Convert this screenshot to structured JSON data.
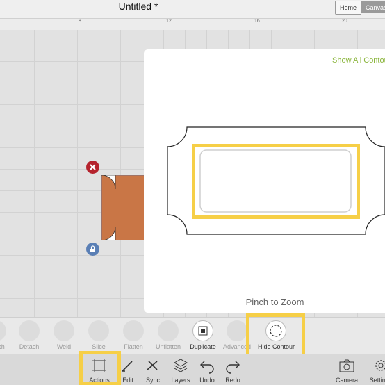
{
  "header": {
    "title": "Untitled *",
    "tabs": [
      "Home",
      "Canvas"
    ]
  },
  "ruler": {
    "ticks": [
      "8",
      "12",
      "16",
      "20"
    ]
  },
  "panel": {
    "show_all_label": "Show All Contour",
    "hint": "Pinch to Zoom"
  },
  "actions": [
    {
      "label": "Attach",
      "icon": "attach-icon"
    },
    {
      "label": "Detach",
      "icon": "detach-icon"
    },
    {
      "label": "Weld",
      "icon": "weld-icon"
    },
    {
      "label": "Slice",
      "icon": "slice-icon"
    },
    {
      "label": "Flatten",
      "icon": "flatten-icon"
    },
    {
      "label": "Unflatten",
      "icon": "unflatten-icon"
    },
    {
      "label": "Duplicate",
      "icon": "duplicate-icon"
    },
    {
      "label": "Advanced",
      "icon": "advanced-icon"
    },
    {
      "label": "Hide Contour",
      "icon": "hide-contour-icon"
    }
  ],
  "toolbar": [
    {
      "label": "Actions",
      "icon": "actions-icon"
    },
    {
      "label": "Edit",
      "icon": "edit-icon"
    },
    {
      "label": "Sync",
      "icon": "sync-icon"
    },
    {
      "label": "Layers",
      "icon": "layers-icon"
    },
    {
      "label": "Undo",
      "icon": "undo-icon"
    },
    {
      "label": "Redo",
      "icon": "redo-icon"
    },
    {
      "label": "Camera",
      "icon": "camera-icon"
    },
    {
      "label": "Settings",
      "icon": "settings-icon"
    }
  ],
  "colors": {
    "highlight": "#f6cf47",
    "shape_fill": "#c97646",
    "accent_green": "#8ab53b",
    "delete": "#b5232d",
    "lock": "#5a7fb5"
  }
}
